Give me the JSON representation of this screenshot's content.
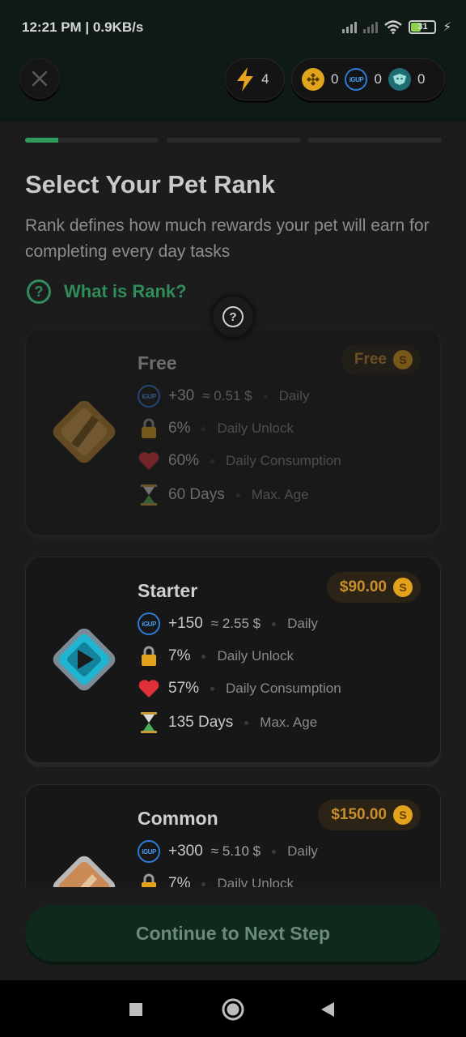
{
  "status_bar": {
    "time": "12:21 PM | 0.9KB/s",
    "battery": "31"
  },
  "header": {
    "energy_count": "4",
    "tokens": [
      {
        "icon": "bnb-coin-icon",
        "value": "0"
      },
      {
        "icon": "igup-coin-icon",
        "value": "0"
      },
      {
        "icon": "pet-coin-icon",
        "value": "0"
      }
    ]
  },
  "progress": {
    "steps": 3,
    "current_step": 1,
    "first_fill": 0.25
  },
  "page": {
    "title": "Select Your Pet Rank",
    "subtitle": "Rank defines how much rewards your pet will earn for completing every day tasks",
    "help_link": "What is Rank?"
  },
  "ranks": [
    {
      "name": "Free",
      "price": "Free",
      "enabled": false,
      "reward": "+30",
      "reward_usd": "≈ 0.51 $",
      "reward_label": "Daily",
      "unlock": "6%",
      "unlock_label": "Daily Unlock",
      "consumption": "60%",
      "consumption_label": "Daily Consumption",
      "age": "60 Days",
      "age_label": "Max. Age"
    },
    {
      "name": "Starter",
      "price": "$90.00",
      "enabled": true,
      "reward": "+150",
      "reward_usd": "≈ 2.55 $",
      "reward_label": "Daily",
      "unlock": "7%",
      "unlock_label": "Daily Unlock",
      "consumption": "57%",
      "consumption_label": "Daily Consumption",
      "age": "135 Days",
      "age_label": "Max. Age"
    },
    {
      "name": "Common",
      "price": "$150.00",
      "enabled": true,
      "reward": "+300",
      "reward_usd": "≈ 5.10 $",
      "reward_label": "Daily",
      "unlock": "7%",
      "unlock_label": "Daily Unlock"
    }
  ],
  "cta": {
    "label": "Continue to Next Step"
  },
  "colors": {
    "accent": "#2f8d5a",
    "gold": "#e3a21b",
    "igup": "#2a7bd6"
  }
}
